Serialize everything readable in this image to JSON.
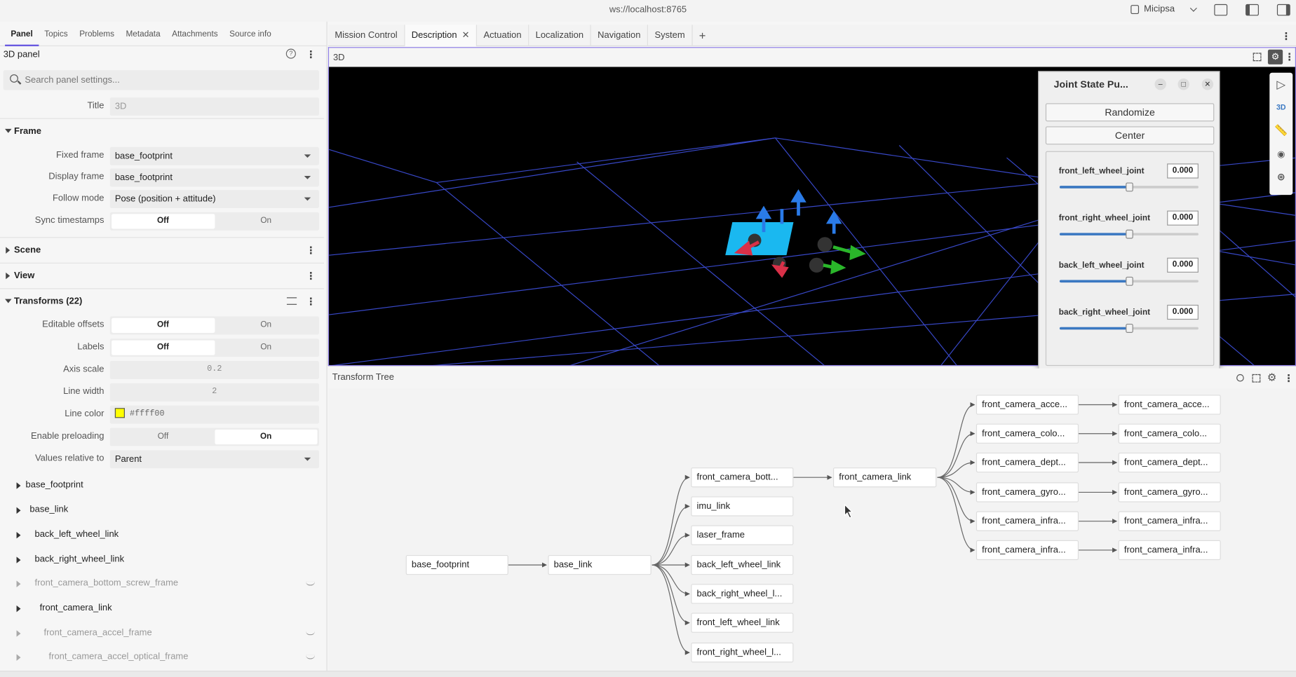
{
  "window": {
    "url": "ws://localhost:8765",
    "user": "Micipsa"
  },
  "left_tabs": [
    "Panel",
    "Topics",
    "Problems",
    "Metadata",
    "Attachments",
    "Source info"
  ],
  "panel": {
    "title": "3D panel",
    "search_placeholder": "Search panel settings...",
    "title_field": {
      "label": "Title",
      "value": "3D"
    },
    "sections": {
      "frame": "Frame",
      "scene": "Scene",
      "view": "View",
      "transforms": "Transforms (22)"
    },
    "frame": {
      "fixed_frame": {
        "label": "Fixed frame",
        "value": "base_footprint"
      },
      "display_frame": {
        "label": "Display frame",
        "value": "base_footprint"
      },
      "follow_mode": {
        "label": "Follow mode",
        "value": "Pose (position + attitude)"
      },
      "sync_timestamps": {
        "label": "Sync timestamps",
        "off": "Off",
        "on": "On"
      }
    },
    "transforms": {
      "editable_offsets": {
        "label": "Editable offsets",
        "off": "Off",
        "on": "On"
      },
      "labels": {
        "label": "Labels",
        "off": "Off",
        "on": "On"
      },
      "axis_scale": {
        "label": "Axis scale",
        "value": "0.2"
      },
      "line_width": {
        "label": "Line width",
        "value": "2"
      },
      "line_color": {
        "label": "Line color",
        "value": "#ffff00"
      },
      "enable_preloading": {
        "label": "Enable preloading",
        "off": "Off",
        "on": "On"
      },
      "values_relative_to": {
        "label": "Values relative to",
        "value": "Parent"
      }
    },
    "frame_list": [
      "base_footprint",
      "base_link",
      "back_left_wheel_link",
      "back_right_wheel_link",
      "front_camera_bottom_screw_frame",
      "front_camera_link",
      "front_camera_accel_frame",
      "front_camera_accel_optical_frame"
    ]
  },
  "tabs": [
    "Mission Control",
    "Description",
    "Actuation",
    "Localization",
    "Navigation",
    "System"
  ],
  "panel3d": {
    "label": "3D",
    "toolbar_3d": "3D"
  },
  "joint_state": {
    "title": "Joint State Pu...",
    "randomize": "Randomize",
    "center": "Center",
    "joints": [
      {
        "name": "front_left_wheel_joint",
        "value": "0.000",
        "position": 0.5
      },
      {
        "name": "front_right_wheel_joint",
        "value": "0.000",
        "position": 0.5
      },
      {
        "name": "back_left_wheel_joint",
        "value": "0.000",
        "position": 0.5
      },
      {
        "name": "back_right_wheel_joint",
        "value": "0.000",
        "position": 0.5
      }
    ]
  },
  "transform_tree": {
    "label": "Transform Tree",
    "root": "base_footprint",
    "base": "base_link",
    "base_children": [
      "front_camera_bott...",
      "imu_link",
      "laser_frame",
      "back_left_wheel_link",
      "back_right_wheel_l...",
      "front_left_wheel_link",
      "front_right_wheel_l..."
    ],
    "camera_link": "front_camera_link",
    "camera_children": [
      "front_camera_acce...",
      "front_camera_colo...",
      "front_camera_dept...",
      "front_camera_gyro...",
      "front_camera_infra...",
      "front_camera_infra..."
    ],
    "camera_grandchildren": [
      "front_camera_acce...",
      "front_camera_colo...",
      "front_camera_dept...",
      "front_camera_gyro...",
      "front_camera_infra...",
      "front_camera_infra..."
    ]
  },
  "icons": [
    "search-icon",
    "help-icon",
    "kebab-icon",
    "close-icon",
    "plus-icon",
    "fullscreen-icon",
    "gear-icon",
    "select-icon",
    "ruler-icon",
    "pin-icon",
    "center-icon",
    "eye-off-icon",
    "filter-icon"
  ]
}
